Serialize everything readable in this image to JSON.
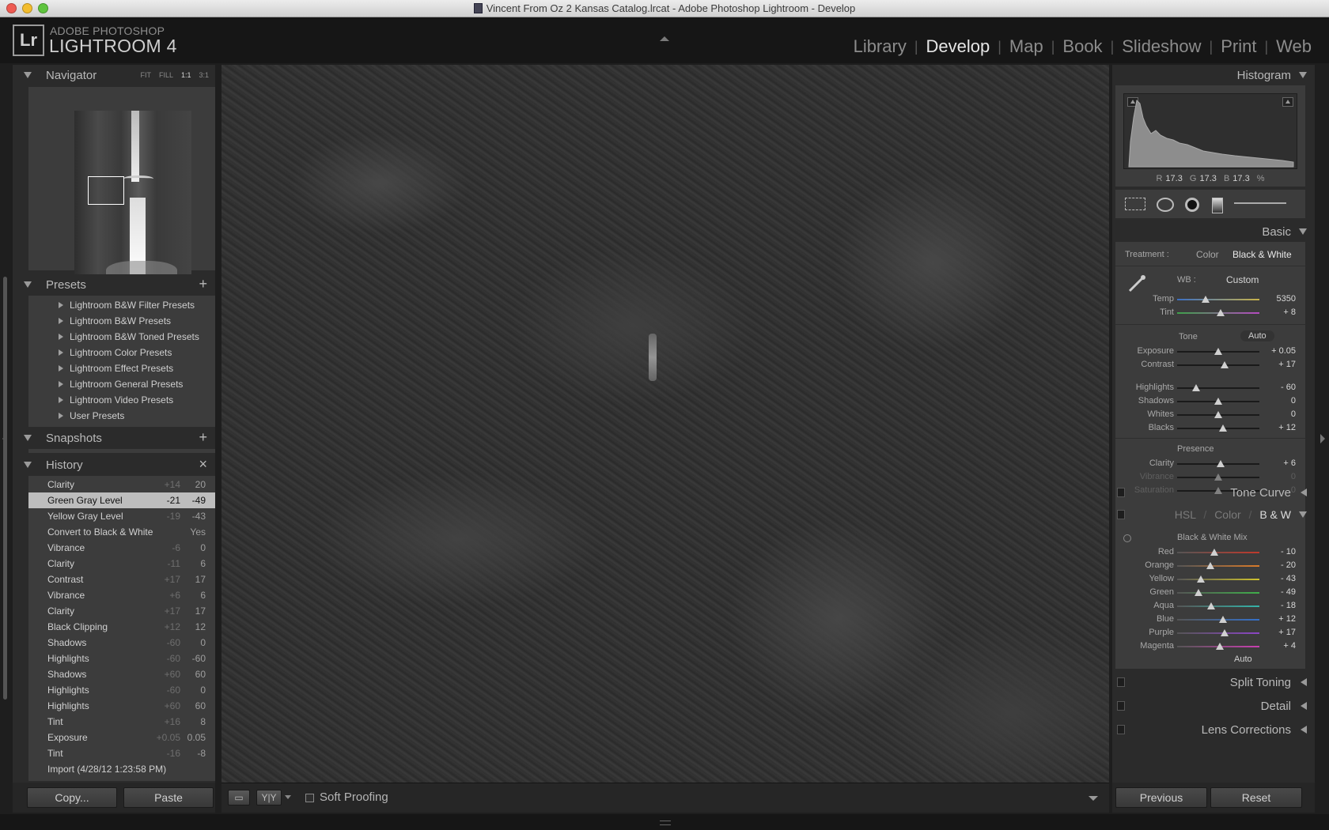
{
  "window": {
    "title": "Vincent From Oz 2 Kansas Catalog.lrcat - Adobe Photoshop Lightroom - Develop"
  },
  "brand": {
    "logo": "Lr",
    "small": "ADOBE PHOTOSHOP",
    "big": "LIGHTROOM 4"
  },
  "modules": [
    "Library",
    "Develop",
    "Map",
    "Book",
    "Slideshow",
    "Print",
    "Web"
  ],
  "active_module": "Develop",
  "navigator": {
    "title": "Navigator",
    "options": [
      "FIT",
      "FILL",
      "1:1",
      "3:1"
    ],
    "active_option": "1:1"
  },
  "presets": {
    "title": "Presets",
    "add": "+",
    "items": [
      "Lightroom B&W Filter Presets",
      "Lightroom B&W Presets",
      "Lightroom B&W Toned Presets",
      "Lightroom Color Presets",
      "Lightroom Effect Presets",
      "Lightroom General Presets",
      "Lightroom Video Presets",
      "User Presets"
    ]
  },
  "snapshots": {
    "title": "Snapshots",
    "add": "+"
  },
  "history": {
    "title": "History",
    "clear": "×",
    "items": [
      {
        "name": "Clarity",
        "delta": "+14",
        "value": "20"
      },
      {
        "name": "Green Gray Level",
        "delta": "-21",
        "value": "-49",
        "selected": true
      },
      {
        "name": "Yellow Gray Level",
        "delta": "-19",
        "value": "-43"
      },
      {
        "name": "Convert to Black & White",
        "delta": "",
        "value": "Yes"
      },
      {
        "name": "Vibrance",
        "delta": "-6",
        "value": "0"
      },
      {
        "name": "Clarity",
        "delta": "-11",
        "value": "6"
      },
      {
        "name": "Contrast",
        "delta": "+17",
        "value": "17"
      },
      {
        "name": "Vibrance",
        "delta": "+6",
        "value": "6"
      },
      {
        "name": "Clarity",
        "delta": "+17",
        "value": "17"
      },
      {
        "name": "Black Clipping",
        "delta": "+12",
        "value": "12"
      },
      {
        "name": "Shadows",
        "delta": "-60",
        "value": "0"
      },
      {
        "name": "Highlights",
        "delta": "-60",
        "value": "-60"
      },
      {
        "name": "Shadows",
        "delta": "+60",
        "value": "60"
      },
      {
        "name": "Highlights",
        "delta": "-60",
        "value": "0"
      },
      {
        "name": "Highlights",
        "delta": "+60",
        "value": "60"
      },
      {
        "name": "Tint",
        "delta": "+16",
        "value": "8"
      },
      {
        "name": "Exposure",
        "delta": "+0.05",
        "value": "0.05"
      },
      {
        "name": "Tint",
        "delta": "-16",
        "value": "-8"
      },
      {
        "name": "Import (4/28/12 1:23:58 PM)",
        "delta": "",
        "value": ""
      }
    ]
  },
  "left_buttons": {
    "copy": "Copy...",
    "paste": "Paste"
  },
  "toolbar": {
    "soft_proofing": "Soft Proofing",
    "compare_label": "Y|Y"
  },
  "histogram": {
    "title": "Histogram",
    "readout": {
      "r_label": "R",
      "r": "17.3",
      "g_label": "G",
      "g": "17.3",
      "b_label": "B",
      "b": "17.3",
      "unit": "%"
    }
  },
  "basic": {
    "title": "Basic",
    "treatment_label": "Treatment :",
    "treatment_color": "Color",
    "treatment_bw": "Black & White",
    "wb_label": "WB :",
    "wb_value": "Custom",
    "tone_label": "Tone",
    "auto": "Auto",
    "presence_label": "Presence",
    "wb_sliders": [
      {
        "label": "Temp",
        "value": "5350",
        "pos": 0.35
      },
      {
        "label": "Tint",
        "value": "+ 8",
        "pos": 0.53
      }
    ],
    "tone_sliders": [
      {
        "label": "Exposure",
        "value": "+ 0.05",
        "pos": 0.5
      },
      {
        "label": "Contrast",
        "value": "+ 17",
        "pos": 0.58
      }
    ],
    "tone_sliders2": [
      {
        "label": "Highlights",
        "value": "- 60",
        "pos": 0.23
      },
      {
        "label": "Shadows",
        "value": "0",
        "pos": 0.5
      },
      {
        "label": "Whites",
        "value": "0",
        "pos": 0.5
      },
      {
        "label": "Blacks",
        "value": "+ 12",
        "pos": 0.56
      }
    ],
    "presence_sliders": [
      {
        "label": "Clarity",
        "value": "+ 6",
        "pos": 0.53,
        "dim": false
      },
      {
        "label": "Vibrance",
        "value": "0",
        "pos": 0.5,
        "dim": true
      },
      {
        "label": "Saturation",
        "value": "0",
        "pos": 0.5,
        "dim": true
      }
    ]
  },
  "tone_curve": {
    "title": "Tone Curve"
  },
  "hsl": {
    "hsl": "HSL",
    "slash": "/",
    "color": "Color",
    "bw": "B & W",
    "mix_title": "Black & White Mix",
    "auto": "Auto",
    "sliders": [
      {
        "label": "Red",
        "value": "- 10",
        "pos": 0.45,
        "color": "#c0392b"
      },
      {
        "label": "Orange",
        "value": "- 20",
        "pos": 0.4,
        "color": "#d87a2a"
      },
      {
        "label": "Yellow",
        "value": "- 43",
        "pos": 0.29,
        "color": "#cfc22e"
      },
      {
        "label": "Green",
        "value": "- 49",
        "pos": 0.26,
        "color": "#3fae4a"
      },
      {
        "label": "Aqua",
        "value": "- 18",
        "pos": 0.41,
        "color": "#34b3a9"
      },
      {
        "label": "Blue",
        "value": "+ 12",
        "pos": 0.56,
        "color": "#3470c9"
      },
      {
        "label": "Purple",
        "value": "+ 17",
        "pos": 0.58,
        "color": "#8b45c6"
      },
      {
        "label": "Magenta",
        "value": "+ 4",
        "pos": 0.52,
        "color": "#c93fb0"
      }
    ]
  },
  "split_toning": {
    "title": "Split Toning"
  },
  "detail": {
    "title": "Detail"
  },
  "lens": {
    "title": "Lens Corrections"
  },
  "right_buttons": {
    "previous": "Previous",
    "reset": "Reset"
  },
  "colors": {
    "accent": "#e6e6e6",
    "panel": "#2b2b2b",
    "panel_inner": "#3c3c3c"
  }
}
